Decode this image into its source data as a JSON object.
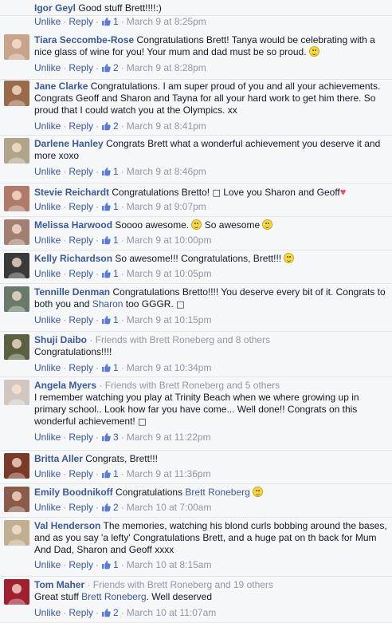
{
  "labels": {
    "unlike": "Unlike",
    "reply": "Reply",
    "dot": "·"
  },
  "comments": [
    {
      "author": "Igor Geyl",
      "segments": [
        {
          "t": "text",
          "v": "Good stuff Brett!!!!:)"
        }
      ],
      "likes": "1",
      "time": "March 9 at 8:25pm",
      "avatar": "none"
    },
    {
      "author": "Tiara Seccombe-Rose",
      "segments": [
        {
          "t": "text",
          "v": "Congratulations Brett! Tanya would be celebrating with a nice glass of wine for you! Your mum and dad must be so proud. "
        },
        {
          "t": "emoji"
        }
      ],
      "likes": "2",
      "time": "March 9 at 8:28pm",
      "avatar": "#c8a58a"
    },
    {
      "author": "Jane Clarke",
      "segments": [
        {
          "t": "text",
          "v": "Congratulations. I am super proud of you and all your achievements. Congrats Geoff and Sharon and Tayna for all your hard work to get him there. So proud that I could watch you at the Olympics. xx"
        }
      ],
      "likes": "2",
      "time": "March 9 at 8:41pm",
      "avatar": "#9a6a4c"
    },
    {
      "author": "Darlene Hanley",
      "segments": [
        {
          "t": "text",
          "v": "Congrats Brett what a wonderful achievement you deserve it and more xoxo"
        }
      ],
      "likes": "1",
      "time": "March 9 at 8:46pm",
      "avatar": "#b0a48a"
    },
    {
      "author": "Stevie Reichardt",
      "segments": [
        {
          "t": "text",
          "v": "Congratulations Bretto! "
        },
        {
          "t": "box"
        },
        {
          "t": "text",
          "v": " Love you Sharon and Geoff"
        },
        {
          "t": "heart"
        }
      ],
      "likes": "1",
      "time": "March 9 at 9:07pm",
      "avatar": "#b07a6a"
    },
    {
      "author": "Melissa Harwood",
      "segments": [
        {
          "t": "text",
          "v": "Soooo awesome. "
        },
        {
          "t": "emoji"
        },
        {
          "t": "text",
          "v": " So awesome "
        },
        {
          "t": "emoji"
        }
      ],
      "likes": "1",
      "time": "March 9 at 10:00pm",
      "avatar": "#a08070"
    },
    {
      "author": "Kelly Richardson",
      "segments": [
        {
          "t": "text",
          "v": "So awesome!!! Congratulations, Brett!!! "
        },
        {
          "t": "emoji"
        }
      ],
      "likes": "1",
      "time": "March 9 at 10:05pm",
      "avatar": "#3a3a3a"
    },
    {
      "author": "Tennille Denman",
      "segments": [
        {
          "t": "text",
          "v": "Congratulations Bretto!!!! You deserve every bit of it. Congrats to both you and "
        },
        {
          "t": "link",
          "v": "Sharon"
        },
        {
          "t": "text",
          "v": " too GGGR. "
        },
        {
          "t": "box"
        }
      ],
      "likes": "1",
      "time": "March 9 at 10:15pm",
      "avatar": "#6a7a6a"
    },
    {
      "author": "Shuji Daibo",
      "friends": "· Friends with Brett Roneberg and 8 others",
      "segments": [
        {
          "t": "text",
          "v": "Congratulations!!!!"
        }
      ],
      "likes": "1",
      "time": "March 9 at 10:34pm",
      "avatar": "#5a6040"
    },
    {
      "author": "Angela Myers",
      "friends": "· Friends with Brett Roneberg and 5 others",
      "segments": [
        {
          "t": "text",
          "v": "I remember watching you play at Trinity Beach when we where growing up in primary school.. Look how far you have come... Well done!! Congrats on this wonderful achievement! "
        },
        {
          "t": "box"
        }
      ],
      "likes": "3",
      "time": "March 9 at 11:22pm",
      "avatar": "#d0c8c0"
    },
    {
      "author": "Britta Aller",
      "segments": [
        {
          "t": "text",
          "v": "Congrats, Brett!!!"
        }
      ],
      "likes": "1",
      "time": "March 9 at 11:36pm",
      "avatar": "#7a3a2a"
    },
    {
      "author": "Emily Boodnikoff",
      "segments": [
        {
          "t": "text",
          "v": "Congratulations "
        },
        {
          "t": "link",
          "v": "Brett Roneberg"
        },
        {
          "t": "text",
          "v": " "
        },
        {
          "t": "emoji"
        }
      ],
      "likes": "2",
      "time": "March 10 at 7:00am",
      "avatar": "#8a5a4a"
    },
    {
      "author": "Val Henderson",
      "segments": [
        {
          "t": "text",
          "v": "The memories, watching his blond curls bobbing around the bases, and as you say 'a lefty' Congratulations Brett, and a huge pat on th back for Mum And Dad, Sharon and Geoff xxxx"
        }
      ],
      "likes": "1",
      "time": "March 10 at 8:15am",
      "avatar": "#c0b090"
    },
    {
      "author": "Tom Maher",
      "friends": "· Friends with Brett Roneberg and 19 others",
      "segments": [
        {
          "t": "text",
          "v": "Great stuff "
        },
        {
          "t": "link",
          "v": "Brett Roneberg"
        },
        {
          "t": "text",
          "v": ". Well deserved"
        }
      ],
      "likes": "2",
      "time": "March 10 at 11:07am",
      "avatar": "#a02030"
    }
  ]
}
